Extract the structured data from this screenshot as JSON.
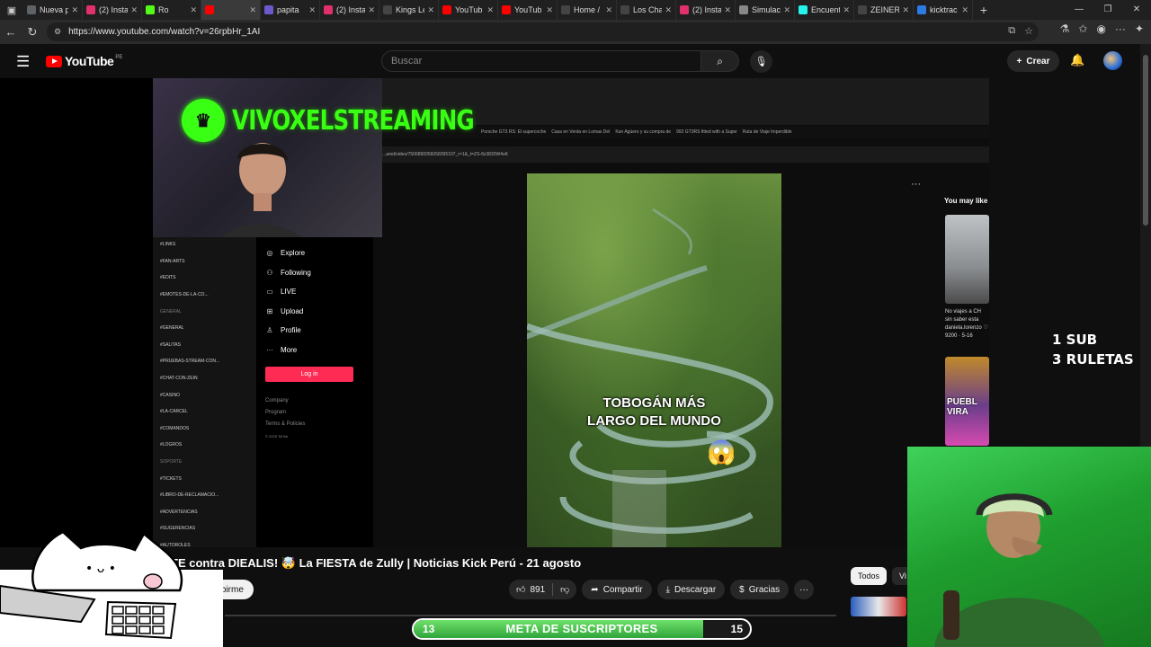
{
  "browser": {
    "tabs": [
      {
        "label": "Nueva p",
        "color": "#5f6368"
      },
      {
        "label": "(2) Insta",
        "color": "#e1306c"
      },
      {
        "label": "Ro",
        "color": "#53fc18"
      },
      {
        "label": "",
        "color": "#ff0000"
      },
      {
        "label": "papita",
        "color": "#6a5acd"
      },
      {
        "label": "(2) Insta",
        "color": "#e1306c"
      },
      {
        "label": "Kings Le",
        "color": "#444444"
      },
      {
        "label": "YouTub",
        "color": "#ff0000"
      },
      {
        "label": "YouTub",
        "color": "#ff0000"
      },
      {
        "label": "Home /",
        "color": "#444444"
      },
      {
        "label": "Los Cha",
        "color": "#444444"
      },
      {
        "label": "(2) Insta",
        "color": "#e1306c"
      },
      {
        "label": "Simulac",
        "color": "#888888"
      },
      {
        "label": "Encuent",
        "color": "#25f4ee"
      },
      {
        "label": "ZEINER",
        "color": "#444444"
      },
      {
        "label": "kicktrac",
        "color": "#2c7be5"
      }
    ],
    "url": "https://www.youtube.com/watch?v=26rpbHr_1AI"
  },
  "yt": {
    "logo_word": "YouTube",
    "region": "PE",
    "search_placeholder": "Buscar",
    "create_label": "Crear"
  },
  "stream": {
    "channel_name": "VIVOXELSTREAMING",
    "overlay_line1": "1 SUB",
    "overlay_line2": "3 RULETAS"
  },
  "screen": {
    "sidebar_channels": [
      {
        "label": "LINKS",
        "cat": false
      },
      {
        "label": "FAN-ARTS",
        "cat": false
      },
      {
        "label": "EDITS",
        "cat": false
      },
      {
        "label": "EMOTES-DE-LA-CO...",
        "cat": false
      },
      {
        "label": "GENERAL",
        "cat": true
      },
      {
        "label": "GENERAL",
        "cat": false
      },
      {
        "label": "SALITAS",
        "cat": false
      },
      {
        "label": "PRUEBAS-STREAM-CON...",
        "cat": false
      },
      {
        "label": "CHAT-CON-ZEIN",
        "cat": false
      },
      {
        "label": "CASINO",
        "cat": false
      },
      {
        "label": "LA-CARCEL",
        "cat": false
      },
      {
        "label": "COMANDOS",
        "cat": false
      },
      {
        "label": "LOGROS",
        "cat": false
      },
      {
        "label": "SOPORTE",
        "cat": true
      },
      {
        "label": "TICKETS",
        "cat": false
      },
      {
        "label": "LIBRO-DE-RECLAMACIO...",
        "cat": false
      },
      {
        "label": "ADVERTENCIAS",
        "cat": false
      },
      {
        "label": "SUGERENCIAS",
        "cat": false
      },
      {
        "label": "AUTOROLES",
        "cat": false
      }
    ],
    "tiktok_nav": [
      {
        "label": "Explore",
        "icon": "compass-icon",
        "glyph": "◎"
      },
      {
        "label": "Following",
        "icon": "following-icon",
        "glyph": "⚇"
      },
      {
        "label": "LIVE",
        "icon": "live-icon",
        "glyph": "▭"
      },
      {
        "label": "Upload",
        "icon": "upload-icon",
        "glyph": "⊞"
      },
      {
        "label": "Profile",
        "icon": "profile-icon",
        "glyph": "♙"
      },
      {
        "label": "More",
        "icon": "more-icon",
        "glyph": "···"
      }
    ],
    "login_label": "Log in",
    "footer": [
      "Company",
      "Program",
      "Terms & Policies"
    ],
    "footer_small": "© 2025 TikTok",
    "inner_tabs": [
      "Porsche GT3 RS: El supercoche",
      "Casa en Venta en Lomas Del",
      "Kun Agüero y su compra de",
      "992 GT3RS fitted with a Super",
      "Ruta de Viaje Imperdible"
    ],
    "inner_url": "...amd/video/7506890056058395107_r=1&_t=ZS-8z3830W4oK",
    "video_caption_1": "TOBOGÁN MÁS",
    "video_caption_2": "LARGO DEL MUNDO",
    "may_like": "You may like",
    "ml_text": "No viajes a CH sin saber esta daniela.lorenzo ♡ 9200 · 5-16",
    "ml_thumb2_text": "PUEBL VIRA"
  },
  "video": {
    "title": "TE contra DIEALIS! 🤯 La FIESTA de Zully | Noticias Kick Perú - 21 agosto",
    "subscribe_label": "Suscribirme",
    "likes": "891",
    "share_label": "Compartir",
    "download_label": "Descargar",
    "thanks_label": "Gracias"
  },
  "chips": [
    "Todos",
    "Vi"
  ],
  "goal": {
    "start": "13",
    "label": "META DE SUSCRIPTORES",
    "end": "15",
    "fill_fraction": 0.86
  }
}
